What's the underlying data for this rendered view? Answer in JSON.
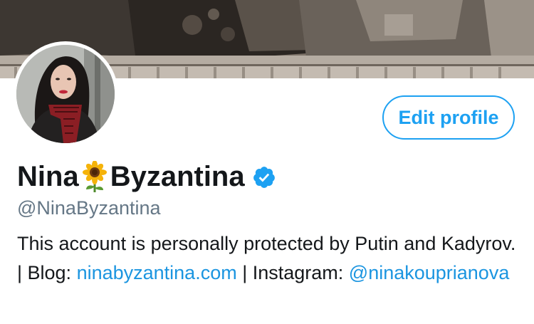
{
  "profile": {
    "name_first": "Nina",
    "name_emoji": "sunflower",
    "name_last": "Byzantina",
    "verified": true,
    "handle": "@NinaByzantina",
    "edit_button": "Edit profile",
    "bio": {
      "text1": "This account is personally protected by Putin and Kadyrov. | Blog: ",
      "blog_link": "ninabyzantina.com",
      "text2": " | Instagram: ",
      "instagram_link": "@ninakouprianova"
    }
  },
  "icons": {
    "verified": "verified-badge-icon",
    "sunflower": "sunflower-emoji-icon"
  },
  "colors": {
    "accent": "#1da1f2",
    "link": "#1b95e0",
    "text": "#14171a",
    "secondary": "#657786"
  }
}
